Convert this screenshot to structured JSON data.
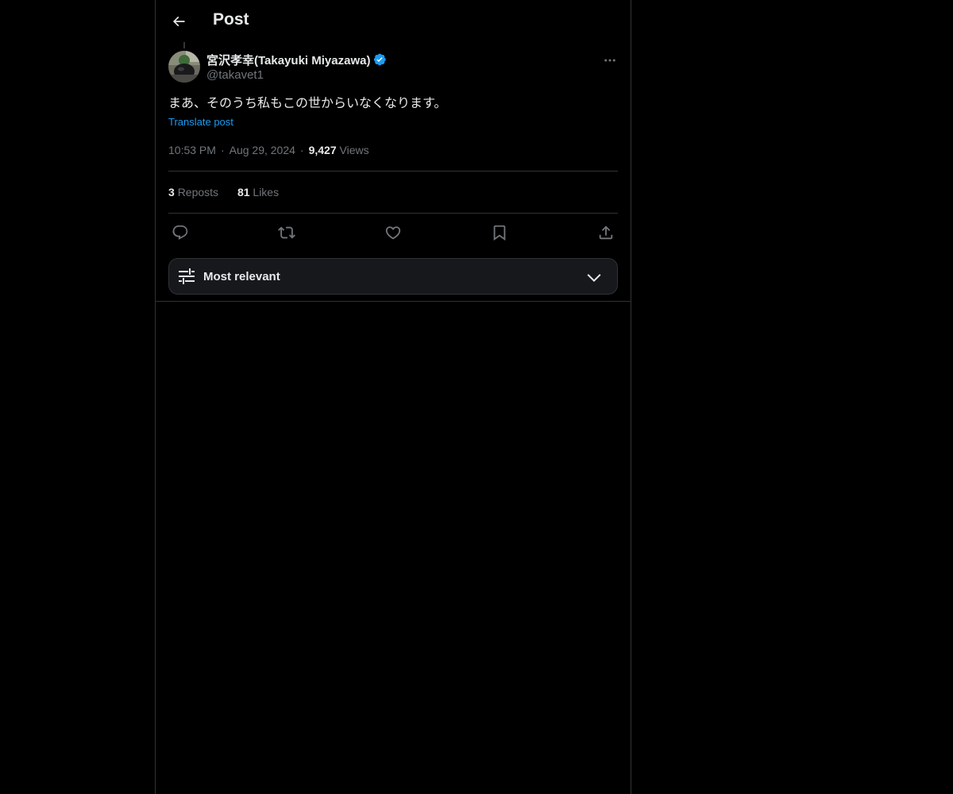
{
  "header": {
    "title": "Post"
  },
  "author": {
    "display_name": "宮沢孝幸(Takayuki Miyazawa)",
    "handle": "@takavet1",
    "verified": true
  },
  "post": {
    "text": "まあ、そのうち私もこの世からいなくなります。",
    "translate_label": "Translate post",
    "time": "10:53 PM",
    "date": "Aug 29, 2024",
    "views_count": "9,427",
    "views_label": "Views"
  },
  "stats": {
    "reposts_count": "3",
    "reposts_label": "Reposts",
    "likes_count": "81",
    "likes_label": "Likes"
  },
  "actions": [
    "reply-icon",
    "repost-icon",
    "like-icon",
    "bookmark-icon",
    "share-icon"
  ],
  "sort": {
    "label": "Most relevant"
  },
  "colors": {
    "accent": "#1d9bf0",
    "muted": "#71767b",
    "border": "#2f3336",
    "background": "#000000"
  }
}
